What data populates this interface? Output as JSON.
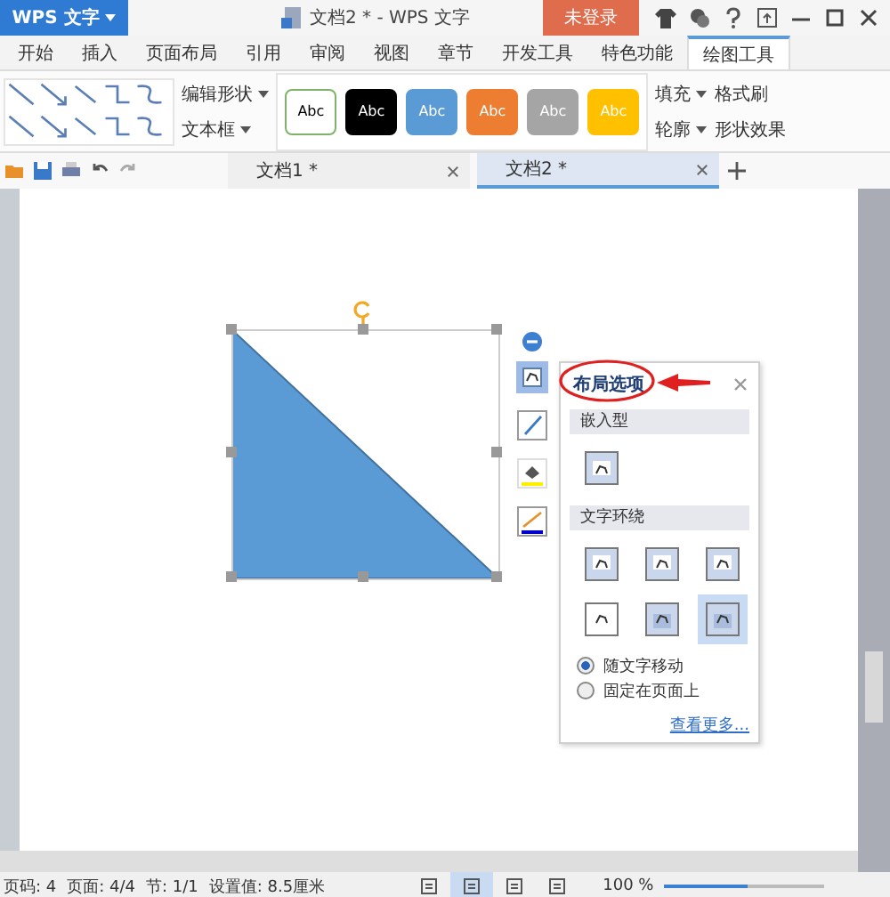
{
  "title_bar": {
    "app_menu": "WPS 文字",
    "title": "文档2 * - WPS 文字",
    "login": "未登录"
  },
  "menu_tabs": [
    {
      "label": "开始",
      "selected": false
    },
    {
      "label": "插入",
      "selected": false
    },
    {
      "label": "页面布局",
      "selected": false
    },
    {
      "label": "引用",
      "selected": false
    },
    {
      "label": "审阅",
      "selected": false
    },
    {
      "label": "视图",
      "selected": false
    },
    {
      "label": "章节",
      "selected": false
    },
    {
      "label": "开发工具",
      "selected": false
    },
    {
      "label": "特色功能",
      "selected": false
    },
    {
      "label": "绘图工具",
      "selected": true
    }
  ],
  "ribbon": {
    "edit_shape": "编辑形状",
    "text_box": "文本框",
    "styles": [
      {
        "label": "Abc",
        "color": "#ffffff"
      },
      {
        "label": "Abc",
        "color": "#000000"
      },
      {
        "label": "Abc",
        "color": "#5b9bd5"
      },
      {
        "label": "Abc",
        "color": "#ed7d31"
      },
      {
        "label": "Abc",
        "color": "#a5a5a5"
      },
      {
        "label": "Abc",
        "color": "#ffc000"
      }
    ],
    "fill": "填充",
    "format_painter": "格式刷",
    "outline": "轮廓",
    "shape_effects": "形状效果"
  },
  "doc_tabs": [
    {
      "label": "文档1 *",
      "selected": false
    },
    {
      "label": "文档2 *",
      "selected": true
    }
  ],
  "layout_panel": {
    "title": "布局选项",
    "inline_heading": "嵌入型",
    "inline_options": [
      {
        "selected": false
      }
    ],
    "wrap_heading": "文字环绕",
    "wrap_options": [
      {
        "selected": false
      },
      {
        "selected": false
      },
      {
        "selected": false
      },
      {
        "selected": false
      },
      {
        "selected": false
      },
      {
        "selected": true
      }
    ],
    "move_options": [
      {
        "label": "随文字移动",
        "selected": true
      },
      {
        "label": "固定在页面上",
        "selected": false
      }
    ],
    "more_link": "查看更多..."
  },
  "status_bar": {
    "items": [
      "页码: 4",
      "页面: 4/4",
      "节: 1/1",
      "设置值: 8.5厘米"
    ],
    "view_modes": [
      {
        "selected": false
      },
      {
        "selected": true
      },
      {
        "selected": false
      },
      {
        "selected": false
      }
    ],
    "zoom": "100 %",
    "zoom_slider": {
      "level": 0.52
    }
  }
}
